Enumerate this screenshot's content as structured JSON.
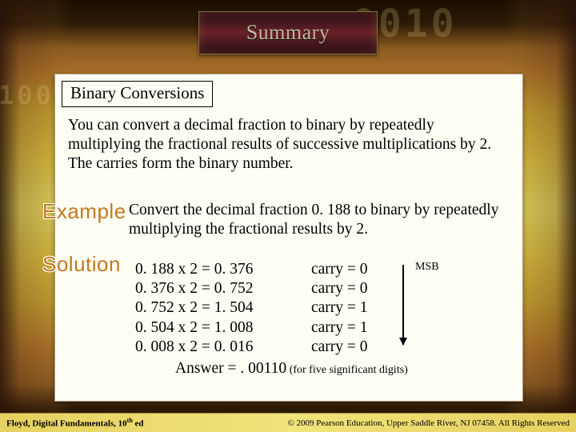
{
  "title": "Summary",
  "section_heading": "Binary Conversions",
  "intro": "You can convert a decimal fraction to binary by repeatedly multiplying the fractional results of successive multiplications by 2. The carries form the binary number.",
  "example_label": "Example",
  "solution_label": "Solution",
  "example_text": "Convert the decimal fraction 0. 188 to binary by repeatedly multiplying the fractional results by 2.",
  "calc": [
    "0. 188 x 2 = 0. 376",
    "0. 376 x 2 = 0. 752",
    "0. 752 x 2 = 1. 504",
    "0. 504 x 2 = 1. 008",
    "0. 008 x 2 = 0. 016"
  ],
  "carries": [
    "carry = 0",
    "carry = 0",
    "carry = 1",
    "carry = 1",
    "carry = 0"
  ],
  "msb_label": "MSB",
  "answer_prefix": "Answer = ",
  "answer_value": ". 00110",
  "answer_note": " (for five significant digits)",
  "footer_left": "Floyd, Digital Fundamentals, 10th ed",
  "footer_right": "© 2009 Pearson Education, Upper Saddle River, NJ 07458. All Rights Reserved"
}
